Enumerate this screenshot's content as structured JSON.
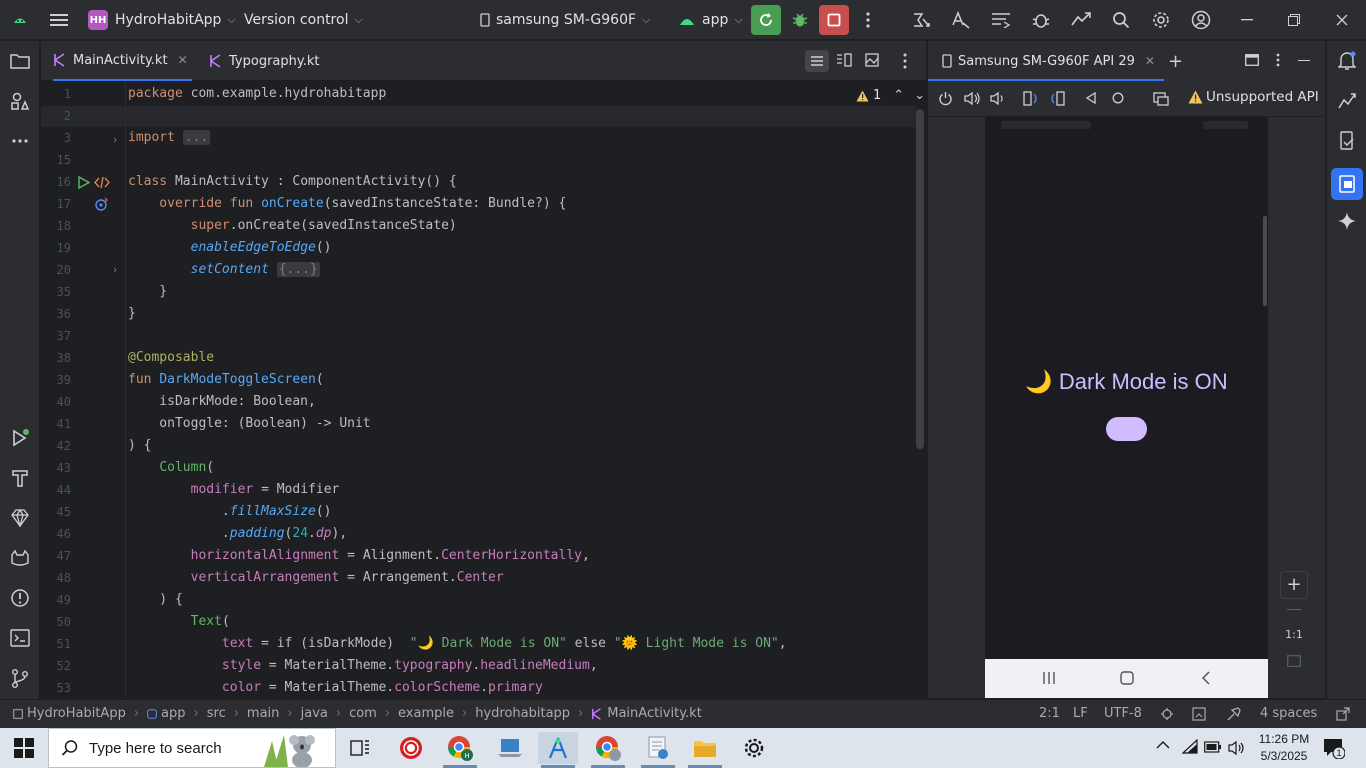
{
  "titlebar": {
    "project_badge": "HH",
    "project_name": "HydroHabitApp",
    "vcs": "Version control",
    "device": "samsung SM-G960F",
    "run_config": "app"
  },
  "editor_tabs": [
    {
      "label": "MainActivity.kt",
      "active": true
    },
    {
      "label": "Typography.kt",
      "active": false
    }
  ],
  "inspection": {
    "warnings": "1"
  },
  "code": {
    "lines": [
      {
        "num": "1"
      },
      {
        "num": "2"
      },
      {
        "num": "3"
      },
      {
        "num": "15"
      },
      {
        "num": "16"
      },
      {
        "num": "17"
      },
      {
        "num": "18"
      },
      {
        "num": "19"
      },
      {
        "num": "20"
      },
      {
        "num": "35"
      },
      {
        "num": "36"
      },
      {
        "num": "37"
      },
      {
        "num": "38"
      },
      {
        "num": "39"
      },
      {
        "num": "40"
      },
      {
        "num": "41"
      },
      {
        "num": "42"
      },
      {
        "num": "43"
      },
      {
        "num": "44"
      },
      {
        "num": "45"
      },
      {
        "num": "46"
      },
      {
        "num": "47"
      },
      {
        "num": "48"
      },
      {
        "num": "49"
      },
      {
        "num": "50"
      },
      {
        "num": "51"
      },
      {
        "num": "52"
      },
      {
        "num": "53"
      }
    ],
    "text": {
      "l1a": "package",
      "l1b": " com.example.hydrohabitapp",
      "l3a": "import",
      "l3b": "...",
      "l16a": "class",
      "l16b": " MainActivity : ComponentActivity() {",
      "l17a": "    override fun",
      "l17b": "onCreate",
      "l17c": "(savedInstanceState: Bundle?) {",
      "l18a": "super",
      "l18b": ".onCreate(savedInstanceState)",
      "l19a": "enableEdgeToEdge",
      "l19b": "()",
      "l20a": "setContent",
      "l20b": "{...}",
      "l35": "    }",
      "l36": "}",
      "l38": "@Composable",
      "l39a": "fun",
      "l39b": "DarkModeToggleScreen",
      "l39c": "(",
      "l40": "    isDarkMode: Boolean,",
      "l41": "    onToggle: (Boolean) -> Unit",
      "l42": ") {",
      "l43a": "Column",
      "l43b": "(",
      "l44a": "modifier",
      "l44b": " = Modifier",
      "l45a": ".",
      "l45b": "fillMaxSize",
      "l45c": "()",
      "l46a": ".",
      "l46b": "padding",
      "l46c": "(",
      "l46d": "24",
      "l46e": ".",
      "l46f": "dp",
      "l46g": "),",
      "l47a": "horizontalAlignment",
      "l47b": " = Alignment.",
      "l47c": "CenterHorizontally",
      "l47d": ",",
      "l48a": "verticalArrangement",
      "l48b": " = Arrangement.",
      "l48c": "Center",
      "l49": "    ) {",
      "l50a": "Text",
      "l50b": "(",
      "l51a": "text",
      "l51b": " = if (isDarkMode)  ",
      "l51c": "\"🌙 Dark Mode is ON\"",
      "l51d": " else ",
      "l51e": "\"🌞 Light Mode is ON\"",
      "l51f": ",",
      "l52a": "style",
      "l52b": " = MaterialTheme.",
      "l52c": "typography",
      "l52d": ".",
      "l52e": "headlineMedium",
      "l52f": ",",
      "l53a": "color",
      "l53b": " = MaterialTheme.",
      "l53c": "colorScheme",
      "l53d": ".",
      "l53e": "primary"
    }
  },
  "device_panel": {
    "tab_label": "Samsung SM-G960F API 29",
    "unsupported": "Unsupported API",
    "phone_text": "🌙 Dark Mode is ON",
    "zoom_label": "1:1"
  },
  "statusbar": {
    "crumbs": [
      "HydroHabitApp",
      "app",
      "src",
      "main",
      "java",
      "com",
      "example",
      "hydrohabitapp",
      "MainActivity.kt"
    ],
    "position": "2:1",
    "line_sep": "LF",
    "encoding": "UTF-8",
    "indent": "4 spaces"
  },
  "taskbar": {
    "search_placeholder": "Type here to search",
    "time": "11:26 PM",
    "date": "5/3/2025",
    "notifications": "1"
  },
  "colors": {
    "accent": "#3574f0",
    "run_green": "#499c54",
    "stop_red": "#c94f4f",
    "toggle_purple": "#d0bcff",
    "phone_text": "#d0bcff"
  }
}
